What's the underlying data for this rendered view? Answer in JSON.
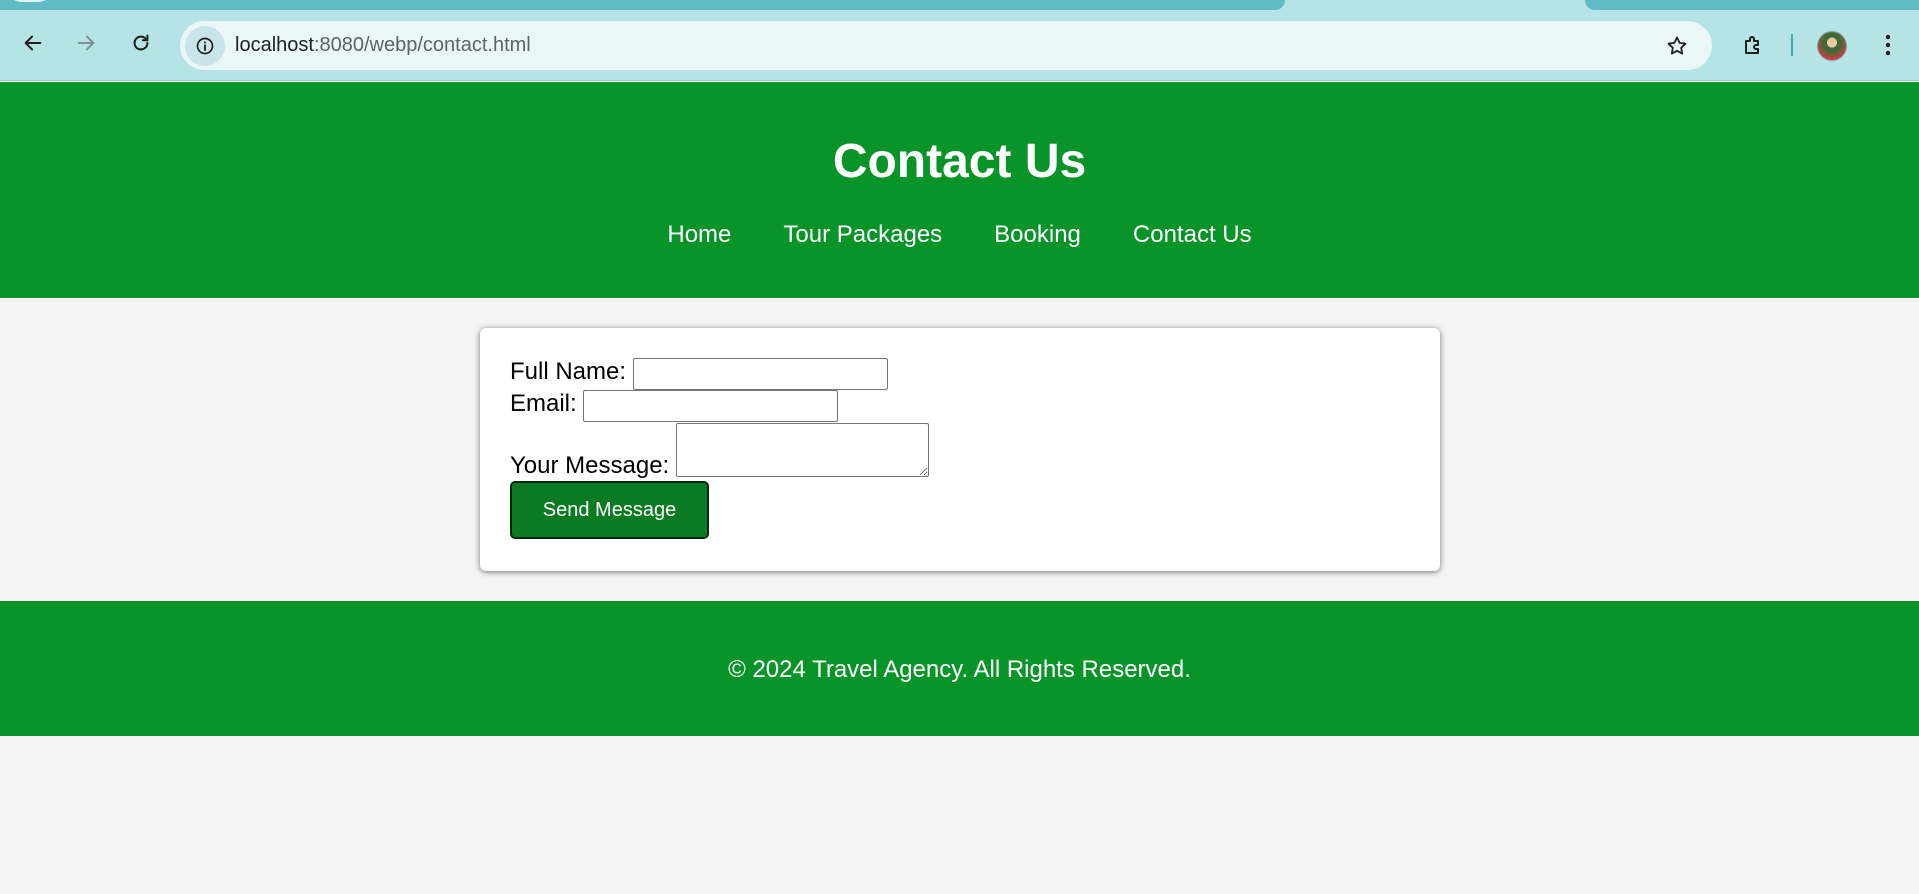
{
  "browser": {
    "url_host": "localhost",
    "url_rest": ":8080/webp/contact.html",
    "icons": {
      "back": "arrow-left-icon",
      "forward": "arrow-right-icon",
      "reload": "reload-icon",
      "site_info": "info-icon",
      "bookmark": "star-icon",
      "extensions": "puzzle-icon",
      "profile": "avatar",
      "menu": "kebab-menu-icon"
    },
    "colors": {
      "chrome": "#b6e3e6",
      "tab_active": "#5fbcc4",
      "omnibox": "#eaf6f7"
    }
  },
  "site": {
    "title": "Contact Us",
    "nav": [
      {
        "label": "Home"
      },
      {
        "label": "Tour Packages"
      },
      {
        "label": "Booking"
      },
      {
        "label": "Contact Us"
      }
    ],
    "colors": {
      "brand_green": "#089428",
      "button_green": "#0b7a22",
      "page_bg": "#f4f4f4"
    }
  },
  "form": {
    "full_name_label": "Full Name:",
    "full_name_value": "",
    "email_label": "Email:",
    "email_value": "",
    "message_label": "Your Message:",
    "message_value": "",
    "submit_label": "Send Message"
  },
  "footer": {
    "text": "© 2024 Travel Agency. All Rights Reserved."
  }
}
